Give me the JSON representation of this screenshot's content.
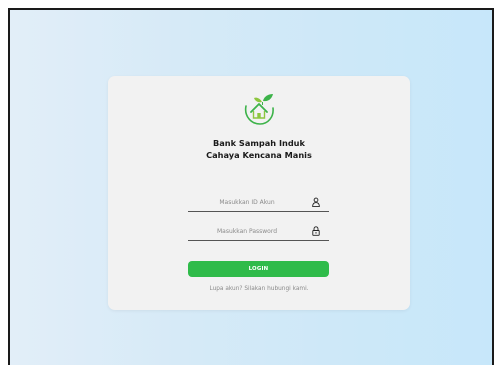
{
  "org": {
    "name_line1": "Bank Sampah Induk",
    "name_line2": "Cahaya Kencana Manis",
    "logo_icon": "leaf-house-logo-icon"
  },
  "form": {
    "id_placeholder": "Masukkan ID Akun",
    "id_value": "",
    "id_icon": "user-icon",
    "password_placeholder": "Masukkan Password",
    "password_value": "",
    "password_icon": "lock-icon",
    "login_label": "LOGIN",
    "forgot_text": "Lupa akun? Silakan hubungi kami."
  },
  "colors": {
    "accent": "#2fbb4a",
    "card": "#f2f2f2",
    "background_start": "#e2eef8",
    "background_end": "#c7e7fa"
  }
}
